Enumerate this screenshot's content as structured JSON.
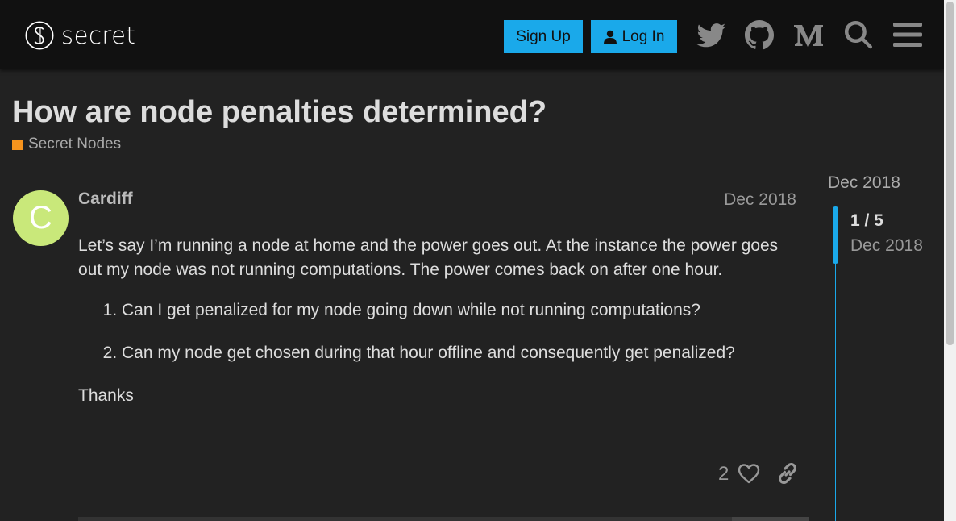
{
  "header": {
    "logo_text": "secret",
    "signup_label": "Sign Up",
    "login_label": "Log In",
    "icons": [
      "twitter-icon",
      "github-icon",
      "medium-icon",
      "search-icon",
      "hamburger-menu-icon"
    ]
  },
  "topic": {
    "title": "How are node penalties determined?",
    "category": "Secret Nodes",
    "category_color": "#f7941d"
  },
  "post": {
    "avatar_letter": "C",
    "avatar_color": "#c9e87a",
    "username": "Cardiff",
    "date": "Dec 2018",
    "paragraph": "Let’s say I’m running a node at home and the power goes out. At the instance the power goes out my node was not running computations. The power comes back on after one hour.",
    "list": [
      "Can I get penalized for my node going down while not running computations?",
      "Can my node get chosen during that hour offline and consequently get penalized?"
    ],
    "closing": "Thanks",
    "like_count": "2"
  },
  "timeline": {
    "start_date": "Dec 2018",
    "position": "1 / 5",
    "current_date": "Dec 2018"
  },
  "colors": {
    "accent": "#1aa9ea",
    "background": "#222222",
    "header": "#111111"
  }
}
